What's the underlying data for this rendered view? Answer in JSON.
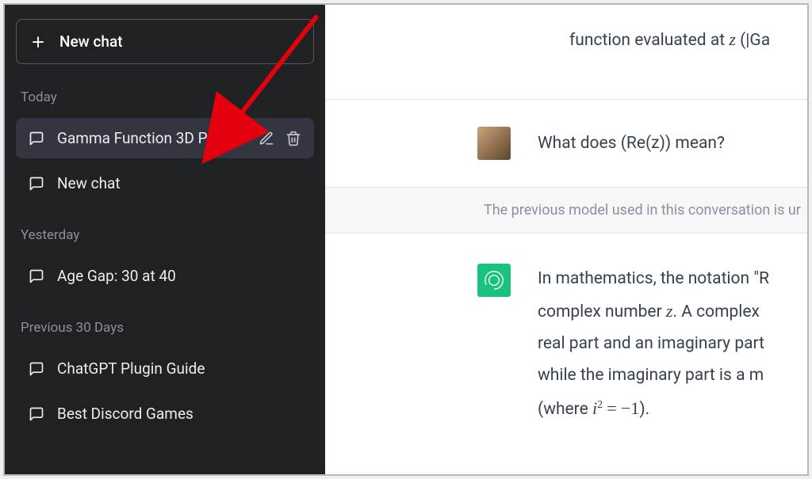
{
  "sidebar": {
    "new_chat_label": "New chat",
    "sections": [
      {
        "label": "Today",
        "items": [
          {
            "label": "Gamma Function 3D Pl",
            "active": true
          },
          {
            "label": "New chat",
            "active": false
          }
        ]
      },
      {
        "label": "Yesterday",
        "items": [
          {
            "label": "Age Gap: 30 at 40",
            "active": false
          }
        ]
      },
      {
        "label": "Previous 30 Days",
        "items": [
          {
            "label": "ChatGPT Plugin Guide",
            "active": false
          },
          {
            "label": "Best Discord Games",
            "active": false
          }
        ]
      }
    ]
  },
  "main": {
    "top_snippet_prefix": "function evaluated at ",
    "top_snippet_var": "z",
    "top_snippet_suffix": " (|Ga",
    "user_message": "What does (Re(z)) mean?",
    "notice": "The previous model used in this conversation is ur",
    "assist_lines": {
      "l1": "In mathematics, the notation \"R",
      "l2_a": "complex number ",
      "l2_var": "z",
      "l2_b": ". A complex",
      "l3": "real part and an imaginary part",
      "l4": "while the imaginary part is a m",
      "l5_a": "(where ",
      "l5_b": ")."
    },
    "math_expr": {
      "base": "i",
      "exp": "2",
      "eq": "=",
      "minus": "−",
      "one": "1"
    }
  }
}
